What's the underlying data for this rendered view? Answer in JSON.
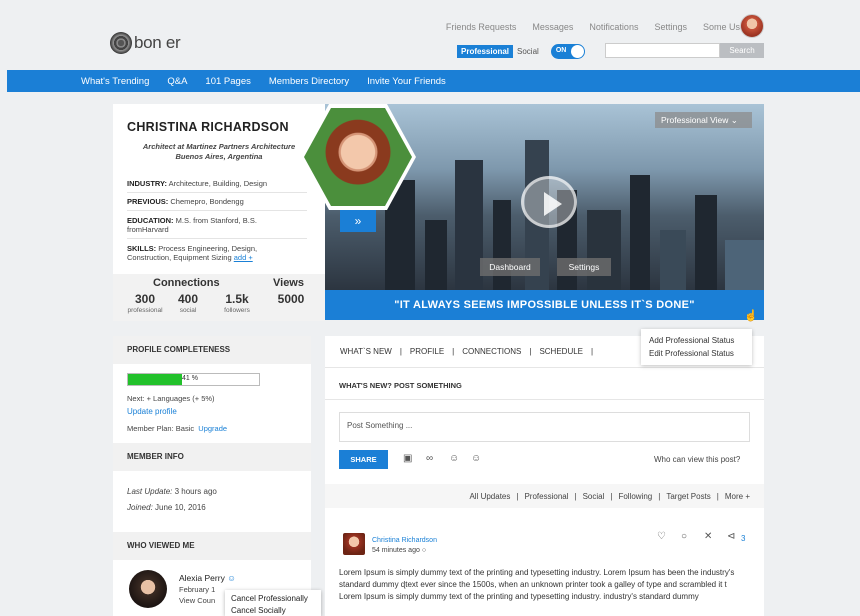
{
  "header": {
    "logo_text": "bon  er",
    "nav": [
      "Friends Requests",
      "Messages",
      "Notifications",
      "Settings",
      "Some User"
    ],
    "mode_professional": "Professional",
    "mode_social": "Social",
    "toggle_state": "ON",
    "search_button": "Search",
    "search_placeholder": ""
  },
  "mainnav": [
    "What's Trending",
    "Q&A",
    "101 Pages",
    "Members Directory",
    "Invite Your Friends"
  ],
  "profile": {
    "name": "CHRISTINA RICHARDSON",
    "title_line1": "Architect at Martinez Partners Architecture",
    "title_line2": "Buenos Aires, Argentina",
    "industry_label": "INDUSTRY:",
    "industry": "Architecture, Building, Design",
    "previous_label": "PREVIOUS:",
    "previous": "Chemepro, Bondengg",
    "education_label": "EDUCATION:",
    "education_line1": "M.S. from Stanford, B.S.",
    "education_line2": "fromHarvard",
    "skills_label": "SKILLS:",
    "skills_line1": "Process Engineering, Design,",
    "skills_line2": "Construction, Equipment Sizing",
    "skills_add": "add +"
  },
  "stats": {
    "connections_label": "Connections",
    "views_label": "Views",
    "professional_count": "300",
    "professional_label": "professional",
    "social_count": "400",
    "social_label": "social",
    "followers_count": "1.5k",
    "followers_label": "followers",
    "views_count": "5000"
  },
  "banner": {
    "view_button": "Professional View",
    "dashboard_button": "Dashboard",
    "settings_button": "Settings",
    "quote": "\"IT ALWAYS SEEMS IMPOSSIBLE UNLESS IT`S DONE\""
  },
  "completeness": {
    "heading": "PROFILE COMPLETENESS",
    "percent_label": "41 %",
    "progress": 0.41,
    "next": "Next:  + Languages (+ 5%)",
    "update_link": "Update profile",
    "plan_label": "Member Plan: Basic",
    "upgrade_link": "Upgrade"
  },
  "member_info": {
    "heading": "MEMBER INFO",
    "last_update_label": "Last Update:",
    "last_update": "3 hours ago",
    "joined_label": "Joined:",
    "joined": "June 10, 2016"
  },
  "who_viewed": {
    "heading": "WHO VIEWED ME",
    "viewer_name": "Alexia  Perry",
    "viewer_line2": "February 1",
    "viewer_line3": "View Coun"
  },
  "context_menu": [
    "Cancel Professionally",
    "Cancel Socially"
  ],
  "tabs": [
    "WHAT`S NEW",
    "PROFILE",
    "CONNECTIONS",
    "SCHEDULE"
  ],
  "status_popup": [
    "Add Professional Status",
    "Edit Professional Status"
  ],
  "post_box": {
    "heading": "WHAT'S NEW? POST SOMETHING",
    "placeholder": "Post Something ...",
    "share_button": "SHARE",
    "visibility_link": "Who can view this post?"
  },
  "filters": [
    "All Updates",
    "Professional",
    "Social",
    "Following",
    "Target Posts",
    "More +"
  ],
  "post": {
    "author": "Christina Richardson",
    "time": "54 minutes ago",
    "share_count": "3",
    "body": "Lorem Ipsum is simply dummy text of the printing and typesetting industry. Lorem Ipsum has been the industry's standard dummy ɖtext ever since the 1500s, when an unknown printer took a galley of type and scrambled it t Lorem Ipsum is simply dummy text of the printing and typesetting industry. industry's standard dummy"
  },
  "colors": {
    "accent": "#1b7fd6",
    "progress": "#22c12b",
    "logo_accent": "#e8732b"
  }
}
